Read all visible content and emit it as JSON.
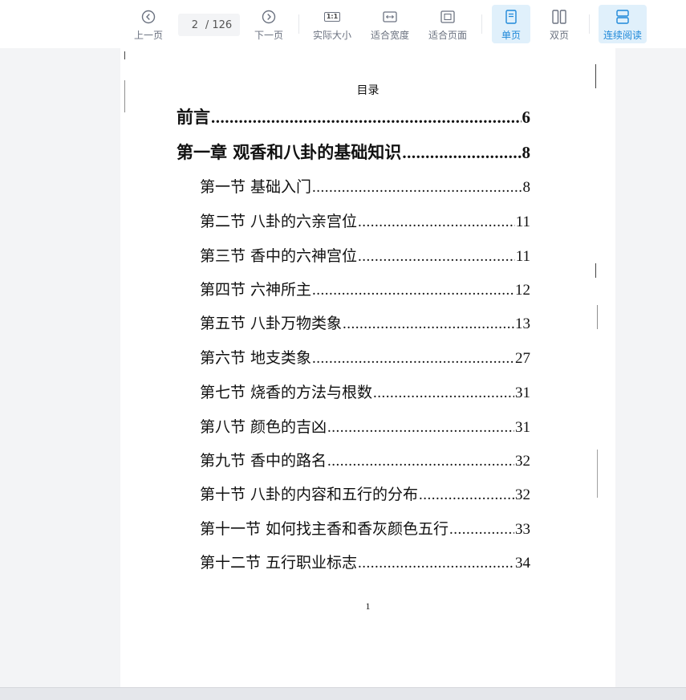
{
  "toolbar": {
    "prev_label": "上一页",
    "page_current": "2",
    "page_total": "/ 126",
    "next_label": "下一页",
    "actual_size_label": "实际大小",
    "fit_width_label": "适合宽度",
    "fit_page_label": "适合页面",
    "single_page_label": "单页",
    "double_page_label": "双页",
    "continuous_label": "连续阅读",
    "actual_size_icon_text": "1:1",
    "accent_color": "#1e88d9"
  },
  "document": {
    "toc_title": "目录",
    "toc": [
      {
        "title": "前言",
        "page": "6",
        "level": 1
      },
      {
        "title": "第一章  观香和八卦的基础知识",
        "page": "8",
        "level": 1
      },
      {
        "title": "第一节  基础入门",
        "page": "8",
        "level": 2
      },
      {
        "title": "第二节  八卦的六亲宫位",
        "page": "11",
        "level": 2
      },
      {
        "title": "第三节  香中的六神宫位",
        "page": "11",
        "level": 2
      },
      {
        "title": "第四节  六神所主",
        "page": "12",
        "level": 2
      },
      {
        "title": "第五节  八卦万物类象",
        "page": "13",
        "level": 2
      },
      {
        "title": "第六节  地支类象",
        "page": "27",
        "level": 2
      },
      {
        "title": "第七节  烧香的方法与根数",
        "page": "31",
        "level": 2
      },
      {
        "title": "第八节  颜色的吉凶",
        "page": "31",
        "level": 2
      },
      {
        "title": "第九节  香中的路名",
        "page": "32",
        "level": 2
      },
      {
        "title": "第十节  八卦的内容和五行的分布",
        "page": "32",
        "level": 2
      },
      {
        "title": "第十一节  如何找主香和香灰颜色五行",
        "page": "33",
        "level": 2
      },
      {
        "title": "第十二节  五行职业标志",
        "page": "34",
        "level": 2
      }
    ],
    "page_footer_number": "1"
  }
}
